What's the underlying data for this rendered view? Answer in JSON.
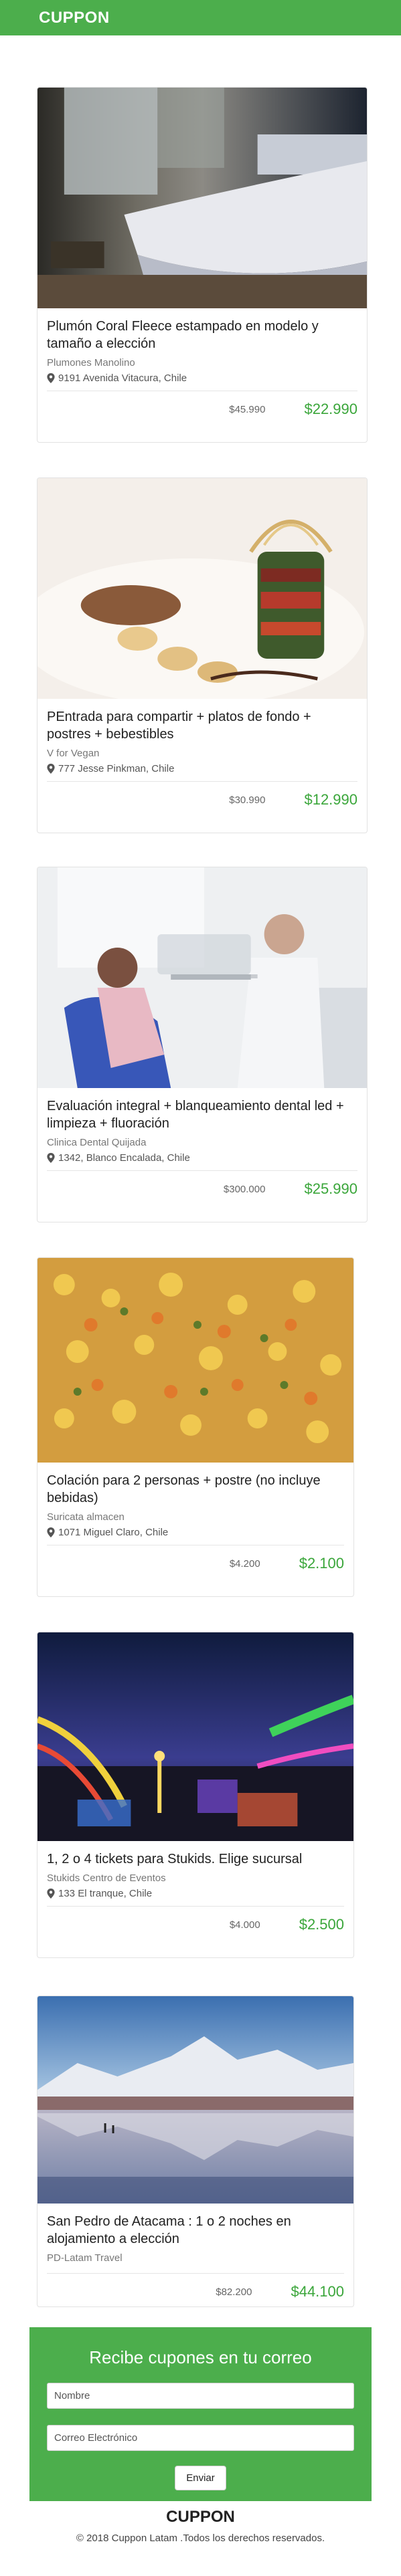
{
  "header": {
    "brand": "CUPPON",
    "brand_color": "#4cae4c"
  },
  "deals": [
    {
      "title": "Plumón Coral Fleece estampado en modelo y tamaño a elección",
      "merchant": "Plumones Manolino",
      "address": "9191 Avenida Vitacura, Chile",
      "old_price": "$45.990",
      "new_price": "$22.990",
      "image": "bedroom-photo"
    },
    {
      "title": "PEntrada para compartir + platos de fondo + postres + bebestibles",
      "merchant": "V for Vegan",
      "address": "777 Jesse Pinkman, Chile",
      "old_price": "$30.990",
      "new_price": "$12.990",
      "image": "vegan-dish-photo"
    },
    {
      "title": "Evaluación integral + blanqueamiento dental led + limpieza + fluoración",
      "merchant": "Clinica Dental Quijada",
      "address": "1342, Blanco Encalada, Chile",
      "old_price": "$300.000",
      "new_price": "$25.990",
      "image": "dental-clinic-photo"
    },
    {
      "title": "Colación para 2 personas + postre (no incluye bebidas)",
      "merchant": "Suricata almacen",
      "address": "1071 Miguel Claro, Chile",
      "old_price": "$4.200",
      "new_price": "$2.100",
      "image": "food-plate-photo"
    },
    {
      "title": "1, 2 o 4 tickets para Stukids. Elige sucursal",
      "merchant": "Stukids Centro de Eventos",
      "address": "133 El tranque, Chile",
      "old_price": "$4.000",
      "new_price": "$2.500",
      "image": "amusement-park-photo"
    },
    {
      "title": "San Pedro de Atacama : 1 o 2 noches en alojamiento a elección",
      "merchant": "PD-Latam Travel",
      "address": "",
      "old_price": "$82.200",
      "new_price": "$44.100",
      "image": "atacama-landscape-photo"
    }
  ],
  "subscribe": {
    "title": "Recibe cupones en tu correo",
    "name_placeholder": "Nombre",
    "email_placeholder": "Correo Electrónico",
    "button_label": "Enviar"
  },
  "footer": {
    "brand": "CUPPON",
    "copyright": "© 2018 Cuppon Latam .Todos los derechos reservados."
  },
  "colors": {
    "price_green": "#3aa63a",
    "accent": "#4cae4c"
  }
}
